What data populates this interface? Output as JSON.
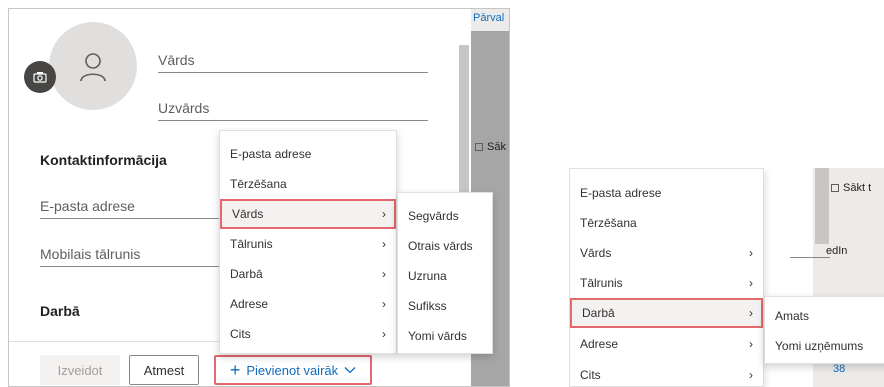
{
  "background": {
    "link_text": "Pārval",
    "checkbox_label": "Sāk",
    "checkbox_label_2": "Sākt t",
    "fragment_text": "edIn",
    "fragment_number": "38"
  },
  "form": {
    "first_name_placeholder": "Vārds",
    "last_name_placeholder": "Uzvārds",
    "contact_section_title": "Kontaktinformācija",
    "email_placeholder": "E-pasta adrese",
    "mobile_placeholder": "Mobilais tālrunis",
    "work_section_title": "Darbā"
  },
  "footer": {
    "create_label": "Izveidot",
    "discard_label": "Atmest",
    "add_more_label": "Pievienot vairāk"
  },
  "menu_main": {
    "items": [
      {
        "label": "E-pasta adrese",
        "submenu": false
      },
      {
        "label": "Tērzēšana",
        "submenu": false
      },
      {
        "label": "Vārds",
        "submenu": true
      },
      {
        "label": "Tālrunis",
        "submenu": true
      },
      {
        "label": "Darbā",
        "submenu": true
      },
      {
        "label": "Adrese",
        "submenu": true
      },
      {
        "label": "Cits",
        "submenu": true
      }
    ],
    "active_item": "Vārds"
  },
  "menu_name": {
    "items": [
      {
        "label": "Segvārds"
      },
      {
        "label": "Otrais vārds"
      },
      {
        "label": "Uzruna"
      },
      {
        "label": "Sufikss"
      },
      {
        "label": "Yomi vārds"
      }
    ]
  },
  "menu_main_2": {
    "items": [
      {
        "label": "E-pasta adrese",
        "submenu": false
      },
      {
        "label": "Tērzēšana",
        "submenu": false
      },
      {
        "label": "Vārds",
        "submenu": true
      },
      {
        "label": "Tālrunis",
        "submenu": true
      },
      {
        "label": "Darbā",
        "submenu": true
      },
      {
        "label": "Adrese",
        "submenu": true
      },
      {
        "label": "Cits",
        "submenu": true
      }
    ],
    "active_item": "Darbā"
  },
  "menu_work": {
    "items": [
      {
        "label": "Amats"
      },
      {
        "label": "Yomi uzņēmums"
      }
    ]
  },
  "icons": {
    "chevron": "›",
    "plus": "+"
  },
  "colors": {
    "accent": "#0f6cbd",
    "highlight_border": "#e3696f",
    "avatar_bg": "#e1dfdd"
  }
}
